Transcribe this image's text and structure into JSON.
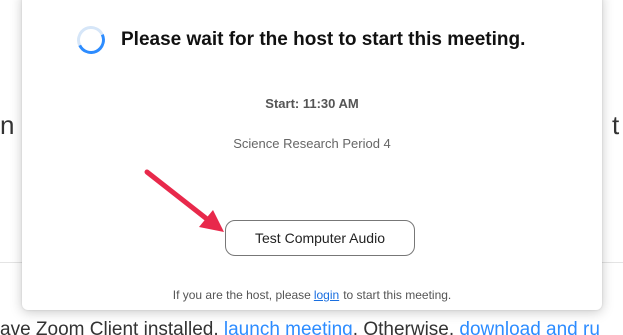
{
  "background": {
    "left_fragment": "n",
    "right_fragment": "t",
    "bottom_text_prefix": "ave Zoom Client installed, ",
    "bottom_link1": "launch meeting",
    "bottom_text_middle": ". Otherwise, ",
    "bottom_link2": "download and ru"
  },
  "dialog": {
    "title": "Please wait for the host to start this meeting.",
    "start_time": "Start: 11:30 AM",
    "meeting_name": "Science Research Period 4",
    "test_audio_button": "Test Computer Audio",
    "host_note_prefix": "If you are the host, please",
    "host_note_link": "login",
    "host_note_suffix": "to start this meeting."
  },
  "icons": {
    "spinner": "loading-spinner-icon",
    "annotation": "red-arrow-icon"
  },
  "colors": {
    "accent": "#2d8cff",
    "arrow": "#e8294b",
    "link": "#1a6fe0"
  }
}
